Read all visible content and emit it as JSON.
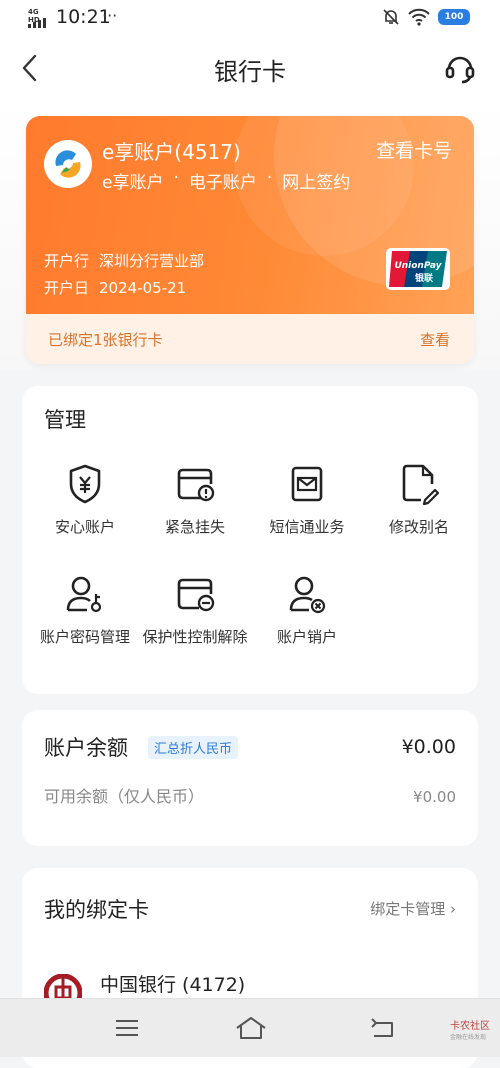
{
  "status_bar": {
    "network": "4G HD",
    "time": "10:21",
    "more": "···",
    "battery": "100"
  },
  "nav": {
    "title": "银行卡"
  },
  "card": {
    "account_name": "e享账户(4517)",
    "view_card_number": "查看卡号",
    "tags": [
      "e享账户",
      "电子账户",
      "网上签约"
    ],
    "tag_separator": "·",
    "branch_label": "开户行",
    "branch_value": "深圳分行营业部",
    "open_date_label": "开户日",
    "open_date_value": "2024-05-21",
    "bound_text": "已绑定1张银行卡",
    "bound_view": "查看",
    "unionpay_en": "UnionPay",
    "unionpay_cn": "银联"
  },
  "manage": {
    "title": "管理",
    "items": [
      {
        "label": "安心账户",
        "icon": "shield-yen-icon"
      },
      {
        "label": "紧急挂失",
        "icon": "card-alert-icon"
      },
      {
        "label": "短信通业务",
        "icon": "sms-mail-icon"
      },
      {
        "label": "修改别名",
        "icon": "doc-edit-icon"
      },
      {
        "label": "账户密码管理",
        "icon": "user-key-icon"
      },
      {
        "label": "保护性控制解除",
        "icon": "card-minus-icon"
      },
      {
        "label": "账户销户",
        "icon": "user-close-icon"
      }
    ]
  },
  "balance": {
    "title": "账户余额",
    "chip": "汇总折人民币",
    "amount": "¥0.00",
    "available_label": "可用余额（仅人民币）",
    "available_amount": "¥0.00"
  },
  "bound_cards": {
    "title": "我的绑定卡",
    "manage_link": "绑定卡管理 ›",
    "bank_name": "中国银行 (4172)"
  },
  "bottom_nav": {
    "watermark": "卡农社区",
    "watermark_sub": "金融在线发现"
  },
  "colors": {
    "card_orange": "#ff8433",
    "strip_bg": "#fff1e5",
    "strip_text": "#d9732a",
    "chip_blue": "#2e7bd6"
  }
}
